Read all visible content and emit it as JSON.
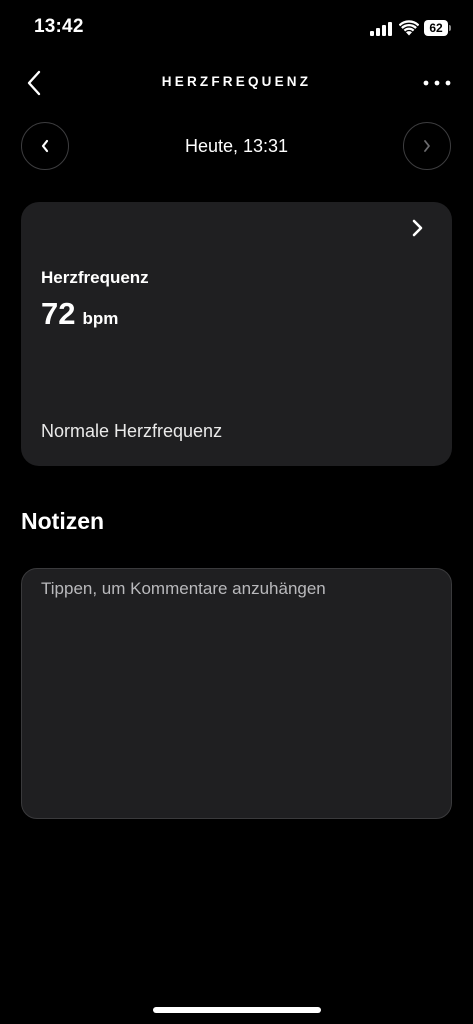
{
  "status_bar": {
    "time": "13:42",
    "battery_level": "62"
  },
  "nav": {
    "title": "HERZFREQUENZ",
    "back_icon": "chevron-left-icon",
    "more_icon": "more-horizontal-icon"
  },
  "date_nav": {
    "label": "Heute, 13:31",
    "prev_icon": "chevron-left-icon",
    "next_icon": "chevron-right-icon"
  },
  "heart_rate_card": {
    "label": "Herzfrequenz",
    "value": "72",
    "unit": "bpm",
    "classification": "Normale Herzfrequenz"
  },
  "notes": {
    "heading": "Notizen",
    "placeholder": "Tippen, um Kommentare anzuhängen",
    "value": ""
  },
  "colors": {
    "background": "#000000",
    "card": "#1f1f21",
    "border": "#3a3a3c",
    "text": "#ffffff",
    "disabled": "#6b6b6e"
  }
}
